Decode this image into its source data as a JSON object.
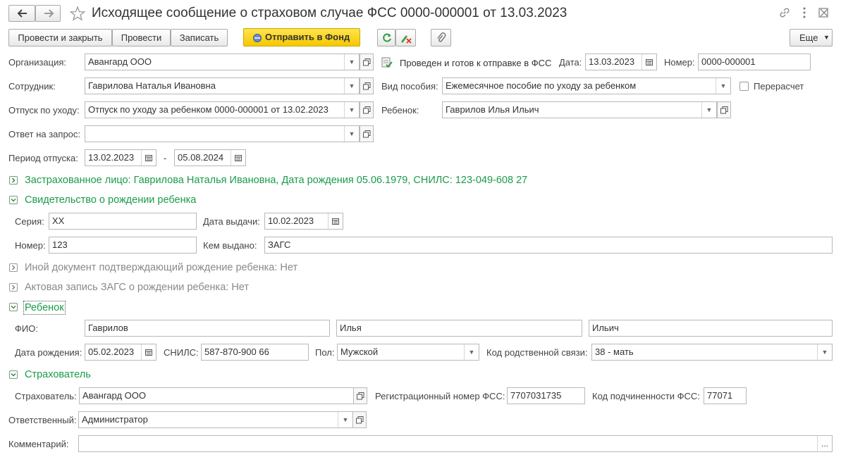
{
  "window": {
    "title": "Исходящее сообщение о страховом случае ФСС 0000-000001 от 13.03.2023"
  },
  "toolbar": {
    "post_close": "Провести и закрыть",
    "post": "Провести",
    "save": "Записать",
    "send": "Отправить в Фонд",
    "more": "Еще"
  },
  "form": {
    "org_label": "Организация:",
    "org_value": "Авангард ООО",
    "status_text": "Проведен и готов к отправке в ФСС",
    "date_label": "Дата:",
    "date_value": "13.03.2023",
    "number_label": "Номер:",
    "number_value": "0000-000001",
    "employee_label": "Сотрудник:",
    "employee_value": "Гаврилова Наталья Ивановна",
    "benefit_label": "Вид пособия:",
    "benefit_value": "Ежемесячное пособие по уходу за ребенком",
    "recalc_label": "Перерасчет",
    "leave_label": "Отпуск по уходу:",
    "leave_value": "Отпуск по уходу за ребенком 0000-000001 от 13.02.2023",
    "child_label": "Ребенок:",
    "child_value": "Гаврилов Илья Ильич",
    "reply_label": "Ответ на запрос:",
    "reply_value": "",
    "period_label": "Период отпуска:",
    "period_from": "13.02.2023",
    "period_dash": "-",
    "period_to": "05.08.2024"
  },
  "insured": {
    "header": "Застрахованное лицо: Гаврилова Наталья Ивановна, Дата рождения 05.06.1979, СНИЛС: 123-049-608 27"
  },
  "certificate": {
    "header": "Свидетельство о рождении ребенка",
    "series_label": "Серия:",
    "series_value": "XX",
    "issue_date_label": "Дата выдачи:",
    "issue_date_value": "10.02.2023",
    "number_label": "Номер:",
    "number_value": "123",
    "issued_by_label": "Кем выдано:",
    "issued_by_value": "ЗАГС"
  },
  "other_doc": {
    "header": "Иной документ подтверждающий рождение ребенка: Нет"
  },
  "act_record": {
    "header": "Актовая запись ЗАГС о рождении ребенка: Нет"
  },
  "child": {
    "header": "Ребенок",
    "fio_label": "ФИО:",
    "last_name": "Гаврилов",
    "first_name": "Илья",
    "middle_name": "Ильич",
    "birth_label": "Дата рождения:",
    "birth_value": "05.02.2023",
    "snils_label": "СНИЛС:",
    "snils_value": "587-870-900 66",
    "sex_label": "Пол:",
    "sex_value": "Мужской",
    "relation_label": "Код родственной связи:",
    "relation_value": "38 - мать"
  },
  "insurer": {
    "header": "Страхователь",
    "insurer_label": "Страхователь:",
    "insurer_value": "Авангард ООО",
    "reg_label": "Регистрационный номер ФСС:",
    "reg_value": "7707031735",
    "sub_label": "Код подчиненности ФСС:",
    "sub_value": "77071",
    "resp_label": "Ответственный:",
    "resp_value": "Администратор",
    "comment_label": "Комментарий:",
    "comment_value": "",
    "comment_btn": "..."
  },
  "colors": {
    "section_green": "#1a9b4a",
    "send_yellow": "#f5c800"
  }
}
